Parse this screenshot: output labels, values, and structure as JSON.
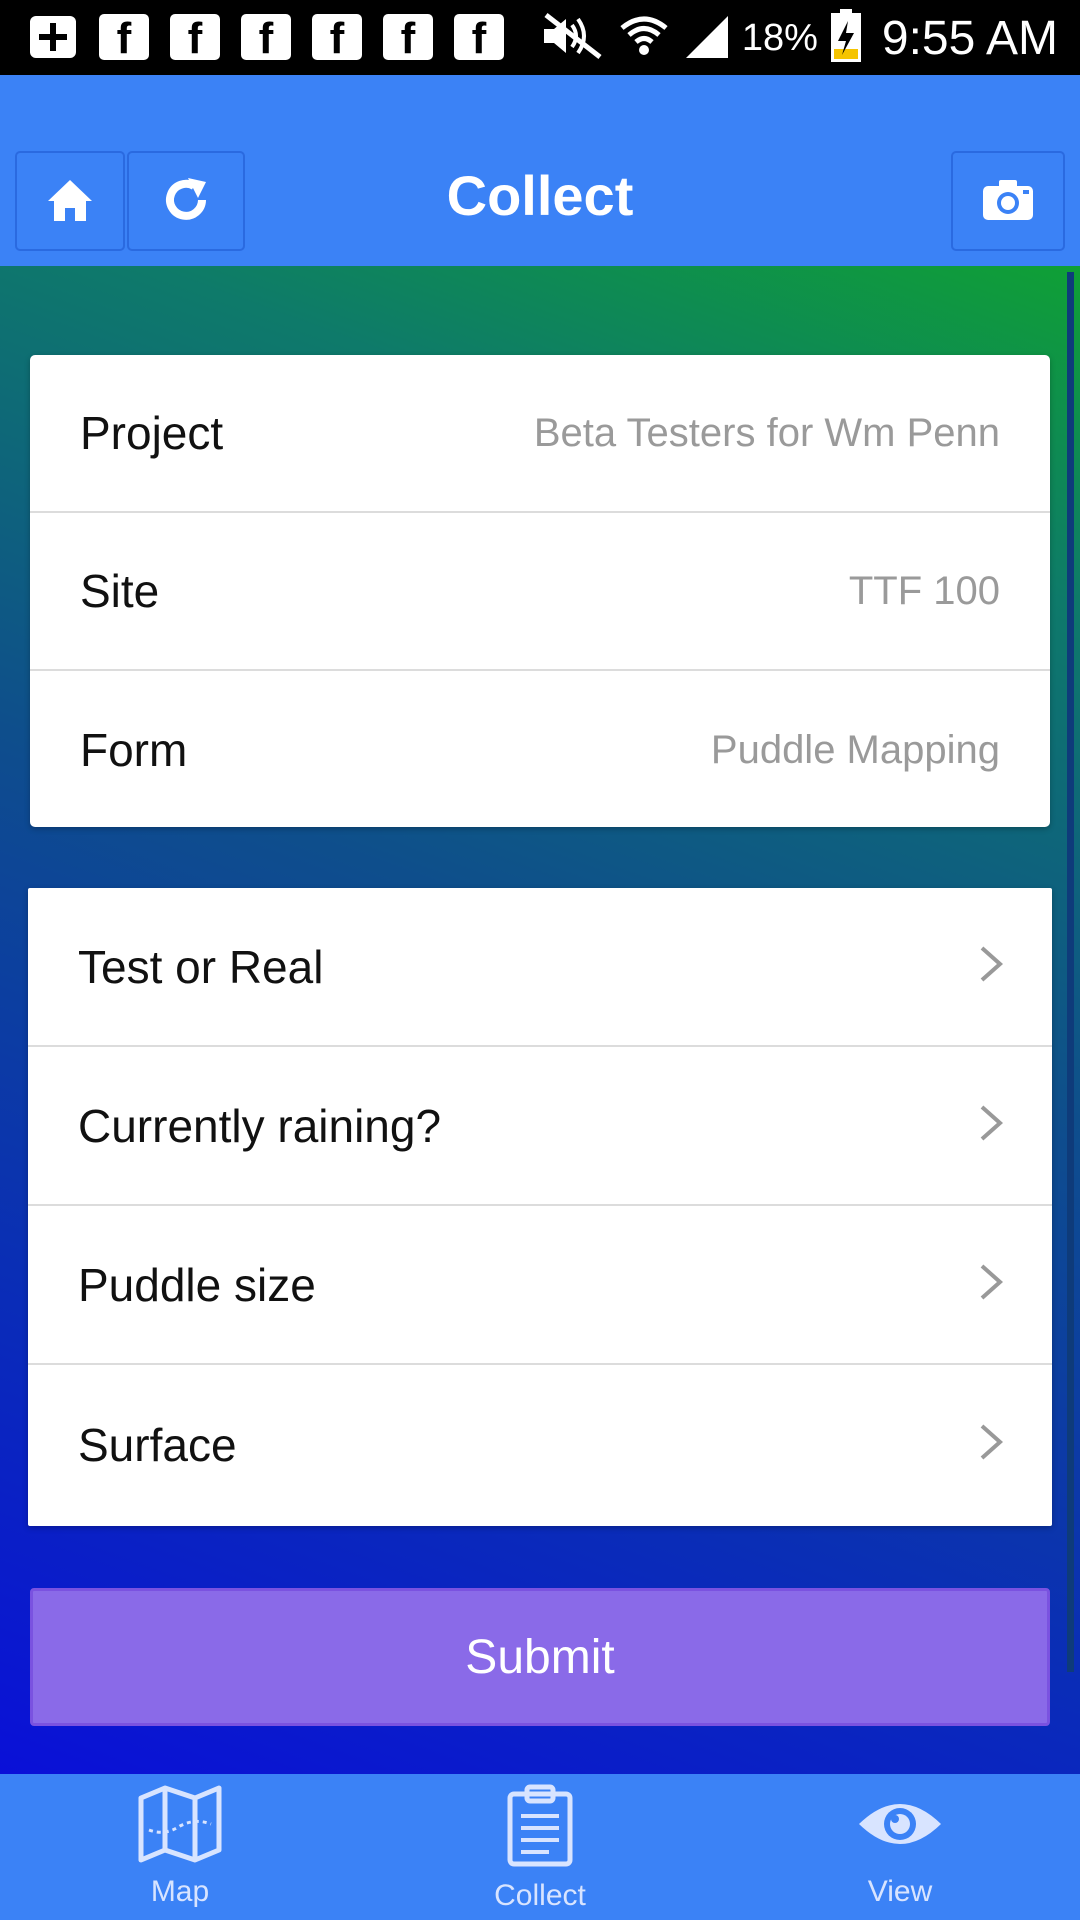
{
  "status_bar": {
    "notification_icons": [
      "add-box-icon",
      "facebook-icon",
      "facebook-icon",
      "facebook-icon",
      "facebook-icon",
      "facebook-icon",
      "facebook-icon"
    ],
    "battery_percent": "18%",
    "time": "9:55 AM"
  },
  "header": {
    "title": "Collect"
  },
  "meta": {
    "project_label": "Project",
    "project_value": "Beta Testers for Wm Penn",
    "site_label": "Site",
    "site_value": "TTF 100",
    "form_label": "Form",
    "form_value": "Puddle Mapping"
  },
  "questions": [
    {
      "label": "Test or Real"
    },
    {
      "label": "Currently raining?"
    },
    {
      "label": "Puddle size"
    },
    {
      "label": "Surface"
    }
  ],
  "submit_label": "Submit",
  "bottom_nav": {
    "items": [
      {
        "label": "Map",
        "icon": "map-icon"
      },
      {
        "label": "Collect",
        "icon": "clipboard-icon"
      },
      {
        "label": "View",
        "icon": "eye-icon"
      }
    ]
  },
  "colors": {
    "accent_blue": "#3b82f6",
    "submit_purple": "#8a6ae8"
  }
}
